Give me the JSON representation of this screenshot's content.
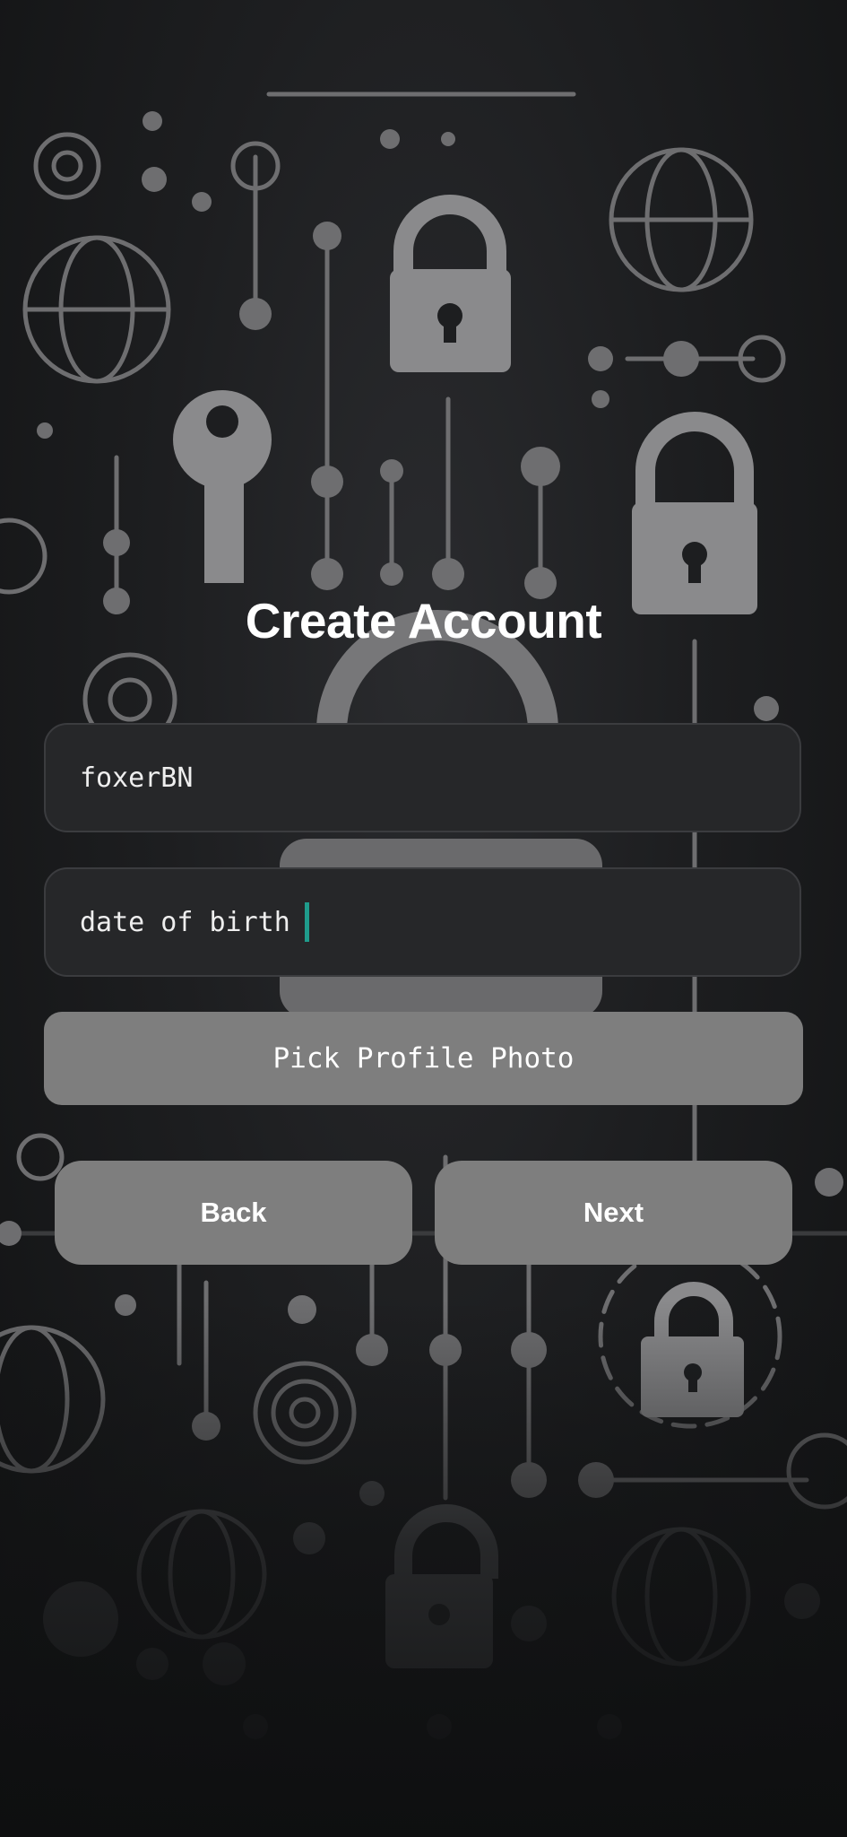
{
  "page": {
    "title": "Create Account"
  },
  "form": {
    "username": {
      "value": "foxerBN"
    },
    "date_of_birth": {
      "value": "date of birth"
    },
    "pick_photo_label": "Pick Profile Photo"
  },
  "actions": {
    "back_label": "Back",
    "next_label": "Next"
  },
  "colors": {
    "accent_cursor": "#1f9c8c",
    "button_gray": "#7e7e7e",
    "field_background": "#262729"
  },
  "background": {
    "pattern_icons": [
      "padlock-icon",
      "key-icon",
      "globe-icon",
      "target-icon",
      "circuit-line"
    ]
  }
}
